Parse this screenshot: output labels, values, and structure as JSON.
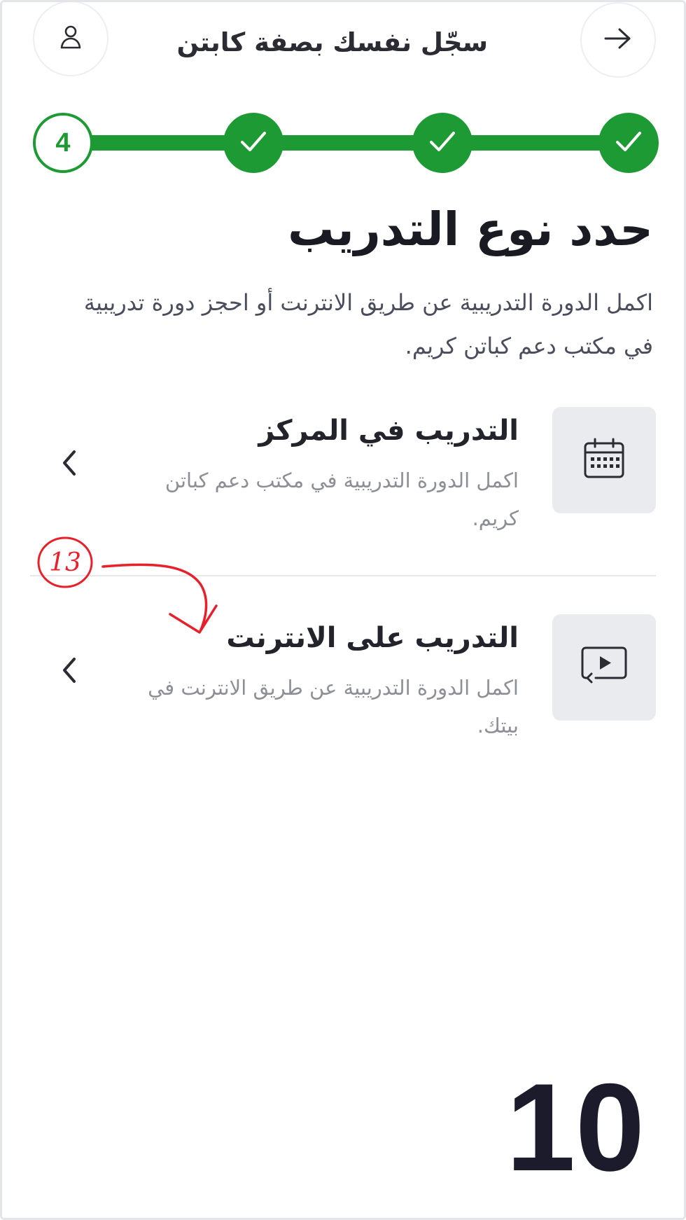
{
  "header": {
    "title": "سجّل نفسك بصفة كابتن",
    "back_icon": "arrow-right-icon",
    "profile_icon": "user-icon"
  },
  "stepper": {
    "total_steps": 4,
    "current_step": "4",
    "completed_icon": "check-icon",
    "accent_color": "#1e9a34"
  },
  "main": {
    "title": "حدد نوع التدريب",
    "subtitle": "اكمل الدورة التدريبية عن طريق الانترنت أو احجز دورة تدريبية في مكتب دعم كباتن كريم."
  },
  "options": [
    {
      "title": "التدريب في المركز",
      "description": "اكمل الدورة التدريبية في مكتب دعم كباتن كريم.",
      "icon": "calendar-icon",
      "chevron": "chevron-left-icon"
    },
    {
      "title": "التدريب على الانترنت",
      "description": "اكمل الدورة التدريبية عن طريق الانترنت في بيتك.",
      "icon": "video-play-icon",
      "chevron": "chevron-left-icon"
    }
  ],
  "annotation": {
    "number": "13",
    "color": "#e8202a"
  },
  "screen_number": "10"
}
